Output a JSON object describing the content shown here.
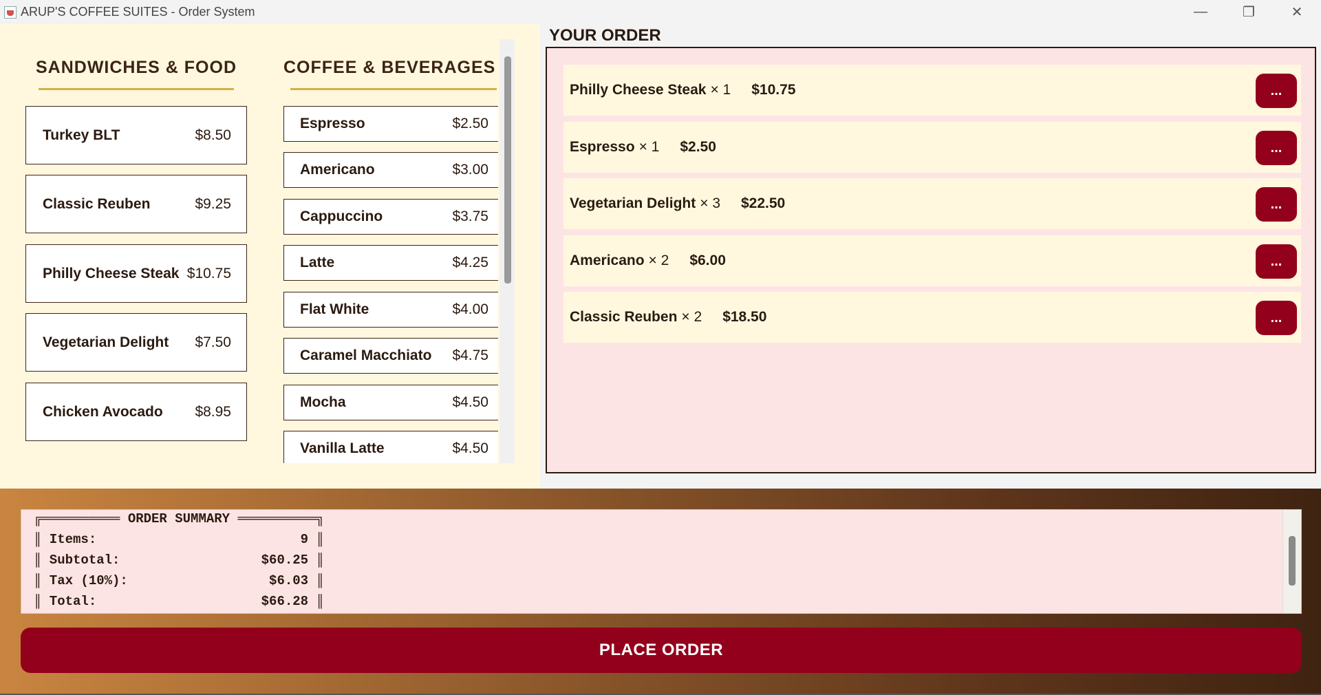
{
  "window": {
    "title": "ARUP'S COFFEE SUITES - Order System",
    "controls": [
      "—",
      "❐",
      "✕"
    ]
  },
  "food": {
    "title": "SANDWICHES & FOOD",
    "items": [
      {
        "name": "Turkey BLT",
        "price": "$8.50"
      },
      {
        "name": "Classic Reuben",
        "price": "$9.25"
      },
      {
        "name": "Philly Cheese Steak",
        "price": "$10.75"
      },
      {
        "name": "Vegetarian Delight",
        "price": "$7.50"
      },
      {
        "name": "Chicken Avocado",
        "price": "$8.95"
      }
    ]
  },
  "beverages": {
    "title": "COFFEE & BEVERAGES",
    "items": [
      {
        "name": "Espresso",
        "price": "$2.50"
      },
      {
        "name": "Americano",
        "price": "$3.00"
      },
      {
        "name": "Cappuccino",
        "price": "$3.75"
      },
      {
        "name": "Latte",
        "price": "$4.25"
      },
      {
        "name": "Flat White",
        "price": "$4.00"
      },
      {
        "name": "Caramel Macchiato",
        "price": "$4.75"
      },
      {
        "name": "Mocha",
        "price": "$4.50"
      },
      {
        "name": "Vanilla Latte",
        "price": "$4.50"
      }
    ]
  },
  "order": {
    "heading": "YOUR ORDER",
    "rows": [
      {
        "name": "Philly Cheese Steak",
        "qty": "× 1",
        "total": "$10.75",
        "action": "..."
      },
      {
        "name": "Espresso",
        "qty": "× 1",
        "total": "$2.50",
        "action": "..."
      },
      {
        "name": "Vegetarian Delight",
        "qty": "× 3",
        "total": "$22.50",
        "action": "..."
      },
      {
        "name": "Americano",
        "qty": "× 2",
        "total": "$6.00",
        "action": "..."
      },
      {
        "name": "Classic Reuben",
        "qty": "× 2",
        "total": "$18.50",
        "action": "..."
      }
    ]
  },
  "summary": {
    "lines": [
      "╔══════════ ORDER SUMMARY ══════════╗",
      "║ Items:                          9 ║",
      "║ Subtotal:                  $60.25 ║",
      "║ Tax (10%):                  $6.03 ║",
      "║ Total:                     $66.28 ║"
    ]
  },
  "place_order_label": "PLACE ORDER",
  "colors": {
    "accent": "#93001c",
    "menu_bg": "#fff8df",
    "order_bg": "#fde4e4",
    "underline": "#d3b141",
    "text": "#2a1a10"
  }
}
